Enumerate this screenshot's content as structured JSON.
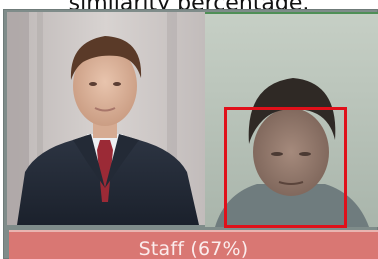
{
  "caption": "similarity percentage.",
  "match": {
    "label": "Staff (67%)",
    "percent": 67
  },
  "colors": {
    "bounding_box": "#e0101a",
    "status_bar": "#d97773",
    "status_text": "#fbecec",
    "match_indicator_line": "#4f8f56"
  },
  "images": {
    "reference_photo": "staff-reference-portrait",
    "camera_capture": "camera-face-capture"
  }
}
